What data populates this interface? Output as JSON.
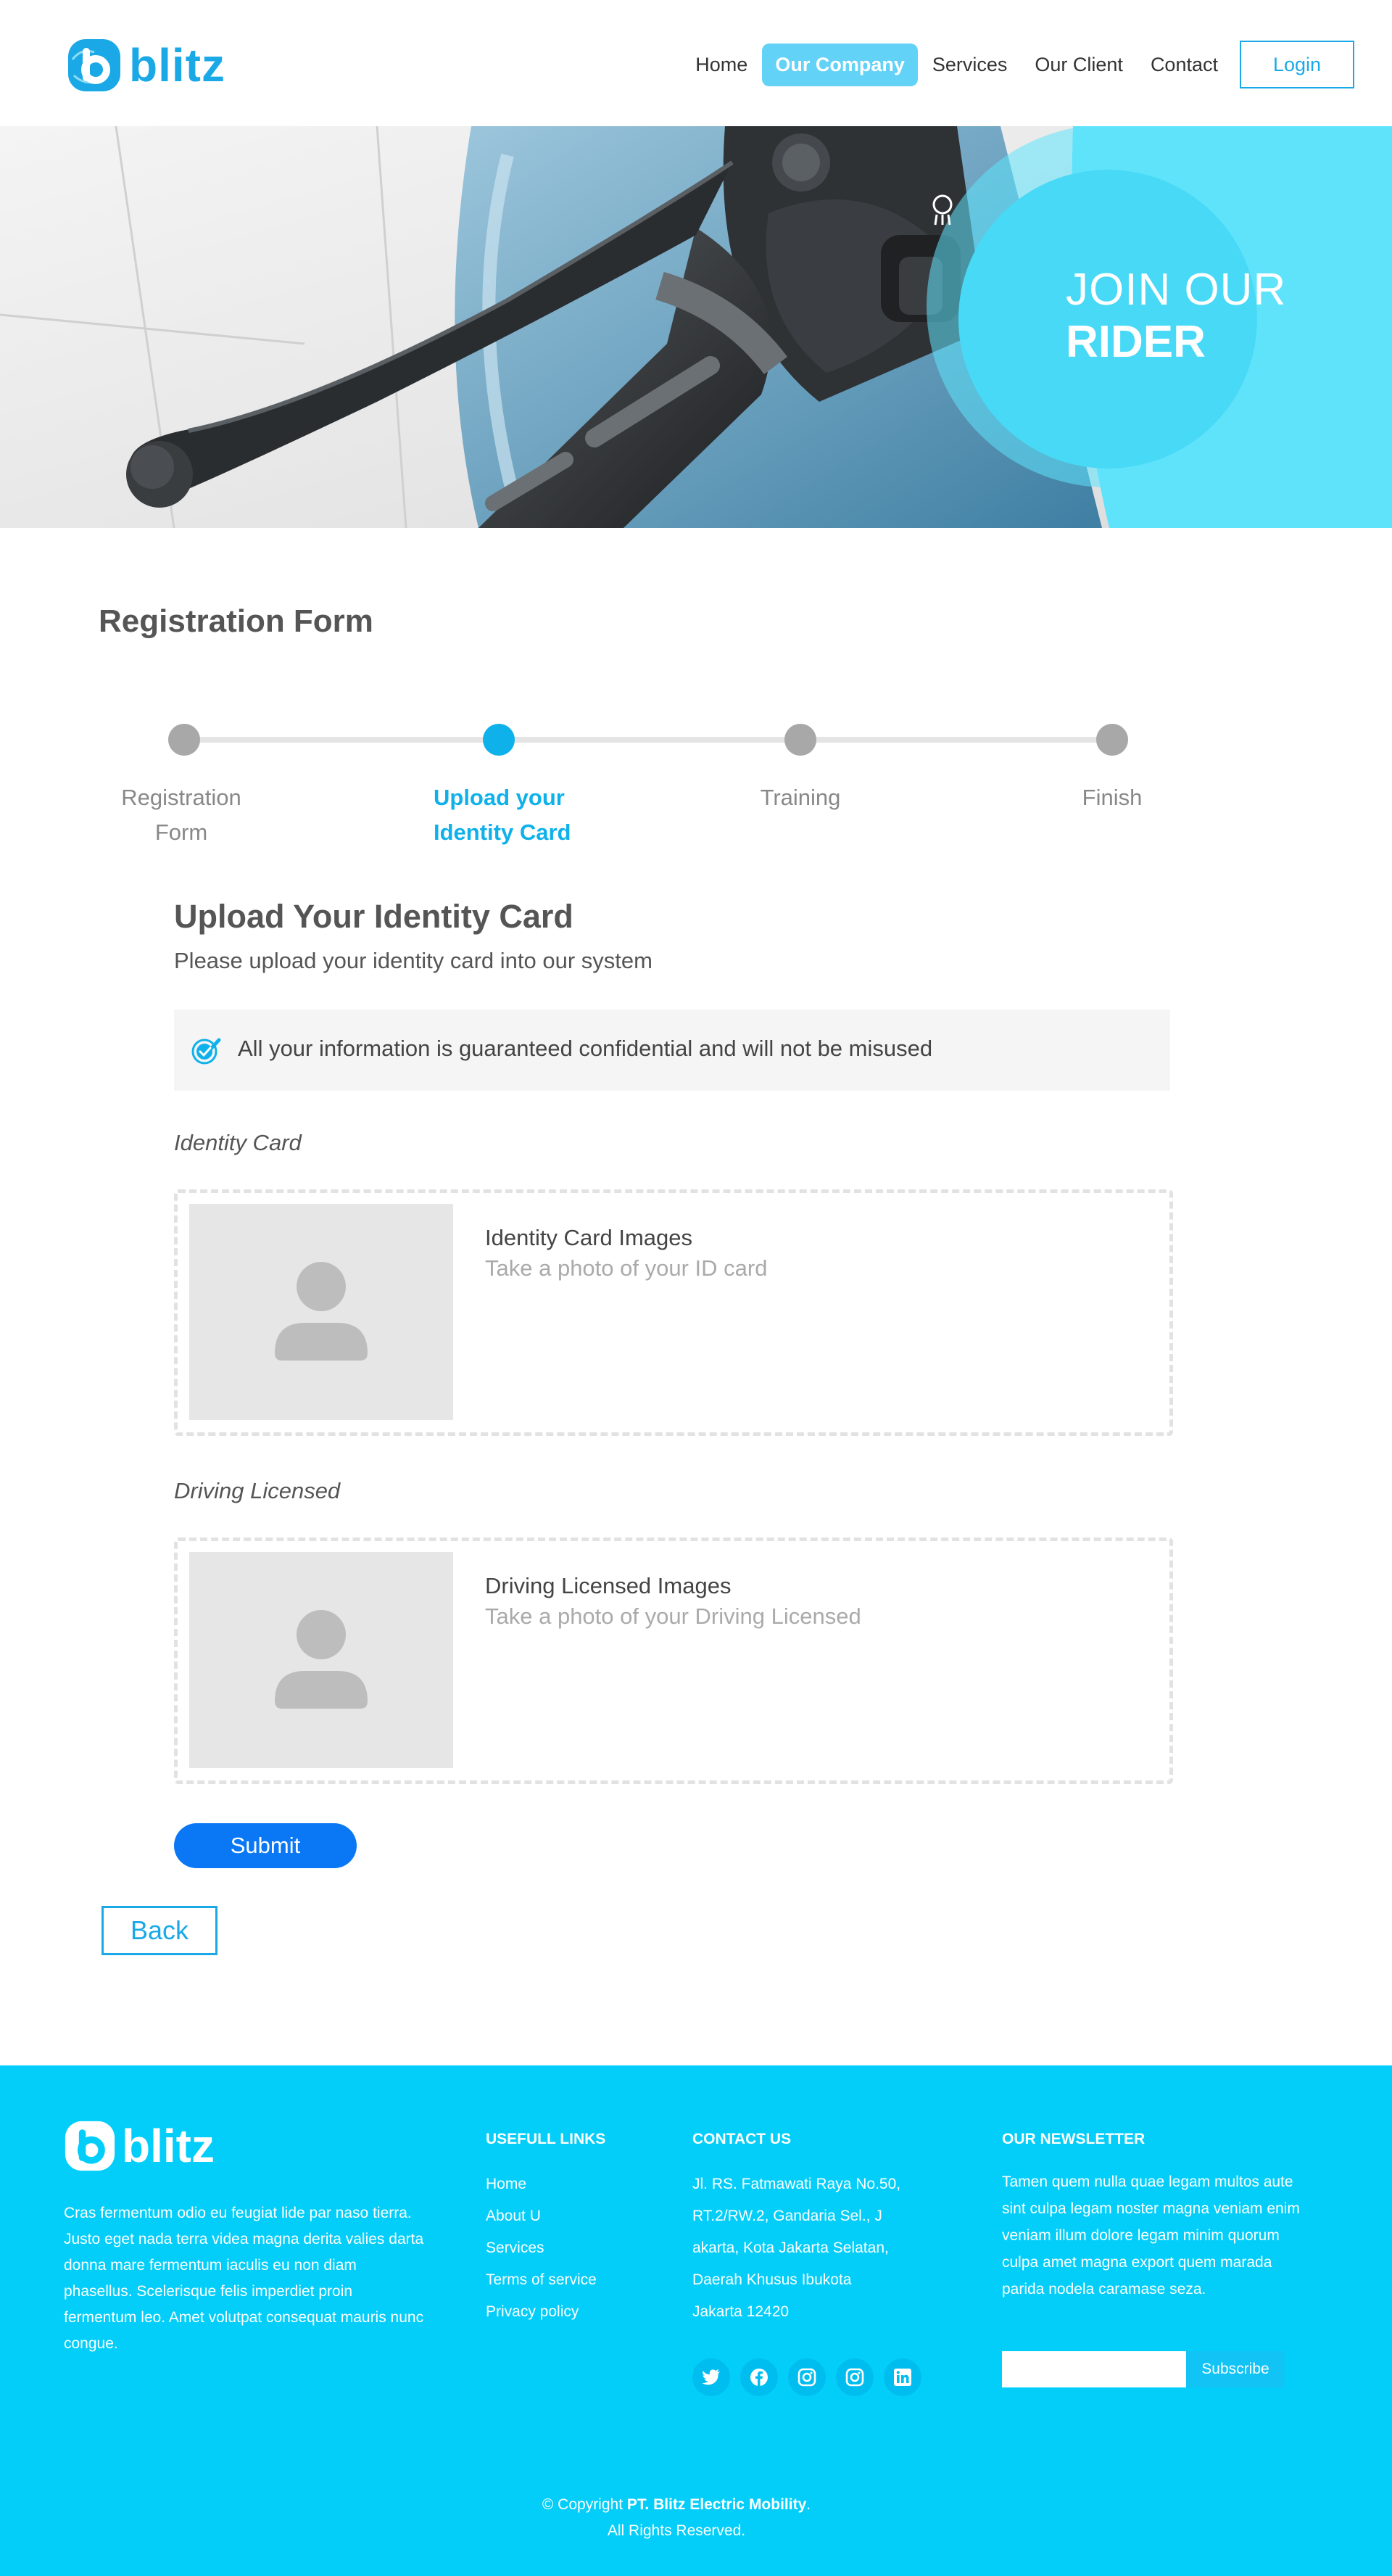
{
  "header": {
    "logo_text": "blitz",
    "nav": [
      "Home",
      "Our Company",
      "Services",
      "Our Client",
      "Contact"
    ],
    "active_nav": "Our Company",
    "login_label": "Login"
  },
  "hero": {
    "title_line1": "JOIN OUR",
    "title_line2": "RIDER",
    "accent_color": "#5fe3fb"
  },
  "main": {
    "page_title": "Registration Form",
    "steps": [
      {
        "line1": "Registration",
        "line2": "Form",
        "active": false
      },
      {
        "line1": "Upload your",
        "line2": "Identity Card",
        "active": true
      },
      {
        "line1": "Training",
        "line2": "",
        "active": false
      },
      {
        "line1": "Finish",
        "line2": "",
        "active": false
      }
    ],
    "section_title": "Upload Your Identity Card",
    "section_subtitle": "Please upload your identity card into our system",
    "notice": "All your information is guaranteed confidential and will not be misused",
    "identity": {
      "label": "Identity Card",
      "title": "Identity Card Images",
      "hint": "Take a photo of your ID card"
    },
    "license": {
      "label": "Driving Licensed",
      "title": "Driving Licensed Images",
      "hint": "Take a photo of your Driving Licensed"
    },
    "submit_label": "Submit",
    "back_label": "Back"
  },
  "footer": {
    "logo_text": "blitz",
    "about": "Cras fermentum odio eu feugiat lide par naso tierra. Justo eget nada terra videa magna derita valies darta donna mare fermentum iaculis eu non diam phasellus. Scelerisque felis imperdiet proin fermentum leo. Amet volutpat consequat mauris nunc congue.",
    "links_title": "USEFULL LINKS",
    "links": [
      "Home",
      "About U",
      "Services",
      "Terms of service",
      "Privacy policy"
    ],
    "contact_title": "CONTACT US",
    "contact_lines": [
      "Jl. RS. Fatmawati Raya No.50,",
      "RT.2/RW.2, Gandaria Sel., J",
      "akarta, Kota Jakarta Selatan,",
      "Daerah Khusus Ibukota",
      "Jakarta 12420"
    ],
    "socials": [
      "twitter-icon",
      "facebook-icon",
      "instagram-icon",
      "instagram-icon",
      "linkedin-icon"
    ],
    "newsletter_title": "OUR NEWSLETTER",
    "newsletter_text": "Tamen quem nulla quae legam multos aute sint culpa legam noster magna veniam enim veniam illum dolore legam minim quorum culpa amet magna export quem marada parida nodela caramase seza.",
    "subscribe_label": "Subscribe",
    "copyright_prefix": "© Copyright ",
    "copyright_company": "PT. Blitz Electric Mobility",
    "copyright_suffix": ".",
    "rights": "All Rights Reserved."
  },
  "colors": {
    "brand": "#1aa9e6",
    "active_step": "#0fb1ea",
    "footer_bg": "#02cef9",
    "submit": "#0a78f5"
  }
}
